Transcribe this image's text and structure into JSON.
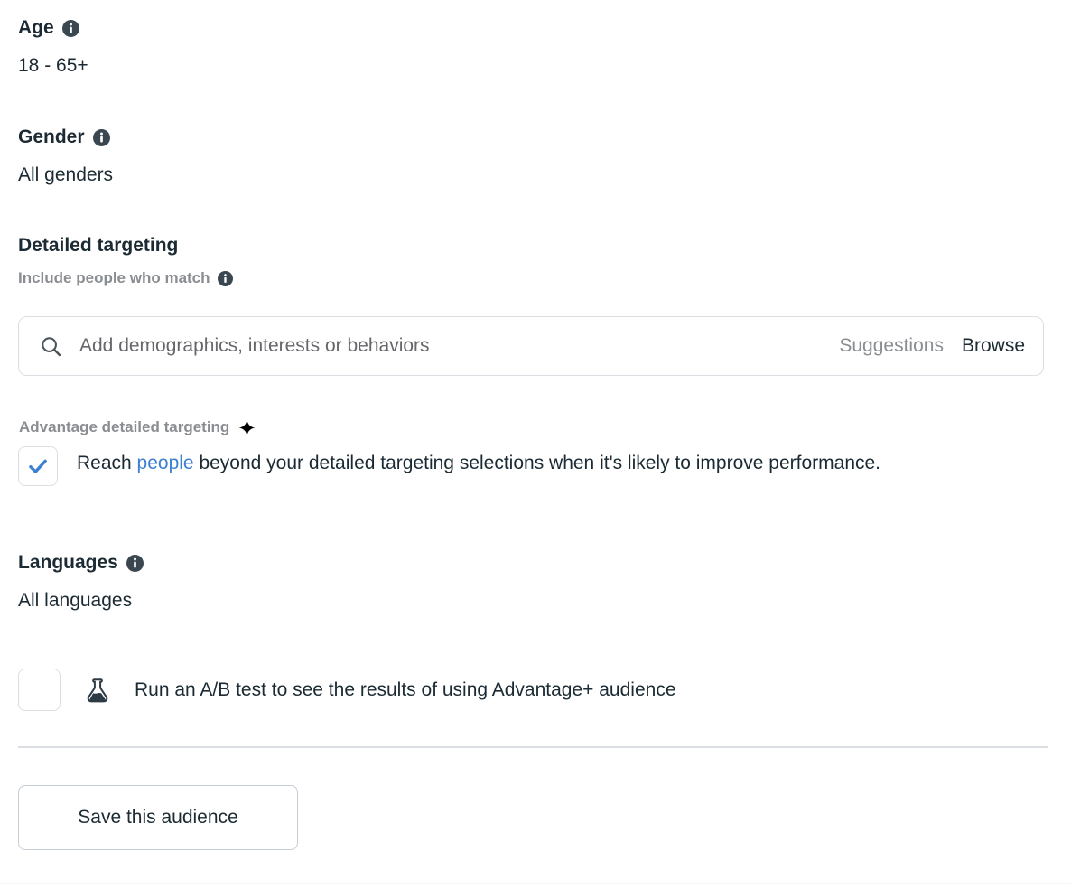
{
  "sections": {
    "age": {
      "title": "Age",
      "info_icon": "info-icon",
      "value": "18 - 65+"
    },
    "gender": {
      "title": "Gender",
      "info_icon": "info-icon",
      "value": "All genders"
    },
    "detailed_targeting": {
      "title": "Detailed targeting",
      "sub_label": "Include people who match",
      "info_icon": "info-icon",
      "search": {
        "icon": "search-icon",
        "placeholder": "Add demographics, interests or behaviors",
        "value": "",
        "suggestions_label": "Suggestions",
        "browse_label": "Browse"
      }
    },
    "advantage": {
      "label": "Advantage detailed targeting",
      "sparkle_icon": "sparkle-icon",
      "checked": true,
      "text_before": "Reach ",
      "link_text": "people",
      "text_after": " beyond your detailed targeting selections when it's likely to improve performance."
    },
    "languages": {
      "title": "Languages",
      "info_icon": "info-icon",
      "value": "All languages"
    },
    "ab_test": {
      "checked": false,
      "flask_icon": "flask-icon",
      "label": "Run an A/B test to see the results of using Advantage+ audience"
    },
    "footer": {
      "save_button_label": "Save this audience"
    }
  },
  "colors": {
    "text_primary": "#1c2b33",
    "text_muted": "#8a8d91",
    "link_blue": "#3c80d1",
    "check_blue": "#3c80d1",
    "border": "#dcdee3",
    "divider": "#dadde1",
    "background": "#ffffff"
  }
}
